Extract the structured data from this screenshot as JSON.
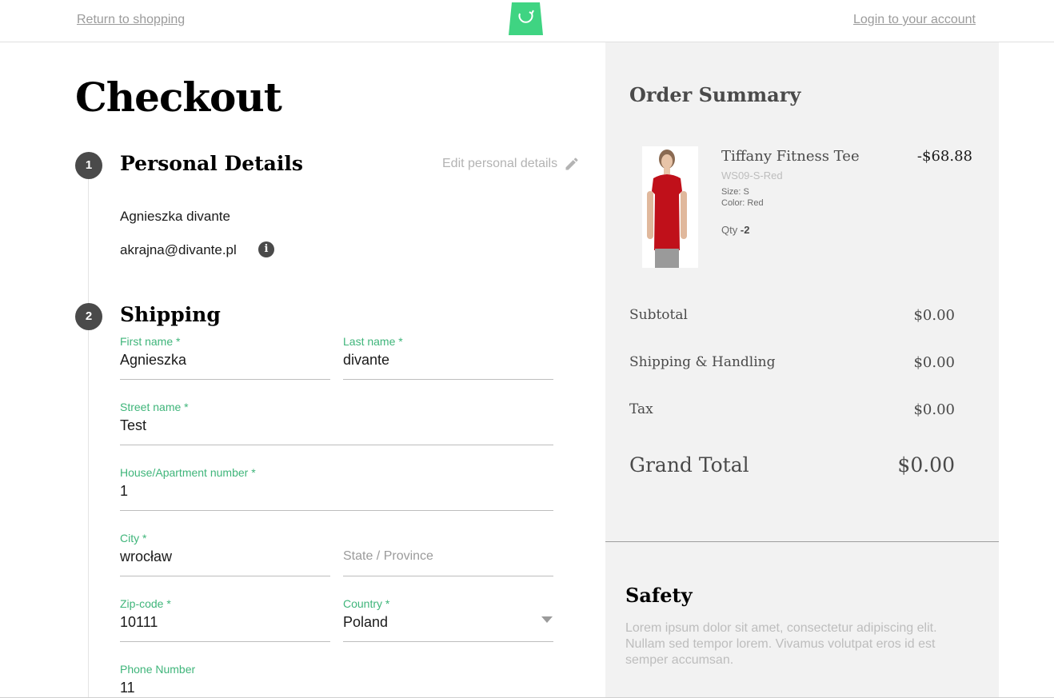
{
  "header": {
    "return_link": "Return to shopping",
    "login_link": "Login to your account",
    "brand_color": "#3fd482"
  },
  "page": {
    "title": "Checkout"
  },
  "personal_details": {
    "step": "1",
    "title": "Personal Details",
    "edit_link": "Edit personal details",
    "name": "Agnieszka divante",
    "email": "akrajna@divante.pl",
    "info_icon": "i"
  },
  "shipping": {
    "step": "2",
    "title": "Shipping",
    "first_name": {
      "label": "First name *",
      "value": "Agnieszka"
    },
    "last_name": {
      "label": "Last name *",
      "value": "divante"
    },
    "street": {
      "label": "Street name *",
      "value": "Test"
    },
    "house": {
      "label": "House/Apartment number *",
      "value": "1"
    },
    "city": {
      "label": "City *",
      "value": "wrocław"
    },
    "state": {
      "placeholder": "State / Province",
      "value": ""
    },
    "zip": {
      "label": "Zip-code *",
      "value": "10111"
    },
    "country": {
      "label": "Country *",
      "value": "Poland"
    },
    "phone": {
      "label": "Phone Number",
      "value": "11"
    }
  },
  "summary": {
    "title": "Order Summary",
    "product": {
      "name": "Tiffany Fitness Tee",
      "sku": "WS09-S-Red",
      "size": "Size: S",
      "color": "Color: Red",
      "qty_label": "Qty",
      "qty_value": "-2",
      "price": "-$68.88"
    },
    "subtotal_label": "Subtotal",
    "subtotal_value": "$0.00",
    "shipping_label": "Shipping & Handling",
    "shipping_value": "$0.00",
    "tax_label": "Tax",
    "tax_value": "$0.00",
    "grand_total_label": "Grand Total",
    "grand_total_value": "$0.00"
  },
  "safety": {
    "title": "Safety",
    "text": "Lorem ipsum dolor sit amet, consectetur adipiscing elit. Nullam sed tempor lorem. Vivamus volutpat eros id est semper accumsan."
  }
}
